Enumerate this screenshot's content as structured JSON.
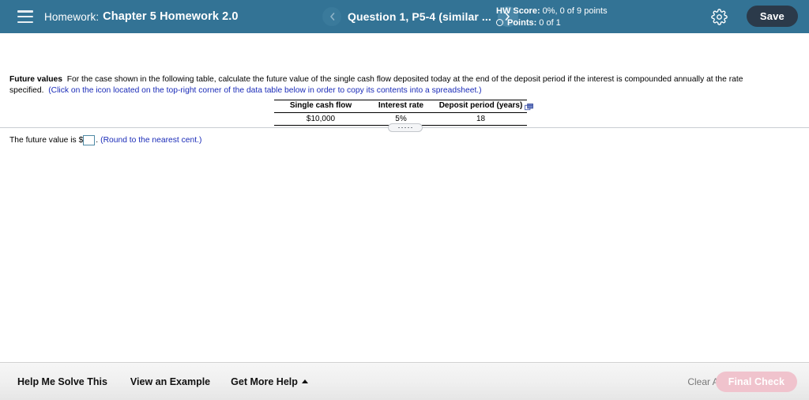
{
  "header": {
    "menu_icon": "hamburger-icon",
    "course_label": "Homework:",
    "assignment_title": "Chapter 5 Homework 2.0",
    "prev_icon": "chevron-left-icon",
    "next_icon": "chevron-right-icon",
    "question_title": "Question 1, P5-4 (similar ...",
    "score": {
      "hw_score_label": "HW Score:",
      "hw_score_value": "0%, 0 of 9 points",
      "points_label": "Points:",
      "points_value": "0 of 1",
      "points_icon": "circle-outline-icon"
    },
    "settings_icon": "gear-icon",
    "save_label": "Save"
  },
  "question": {
    "lead": "Future values",
    "body": "For the case shown in the following table, calculate the future value of the single cash flow deposited today at the end of the deposit period if the interest is compounded annually at the rate specified.",
    "hint_link": "(Click on the icon located on the top-right corner of the data table below in order to copy its contents into a spreadsheet.)",
    "copy_icon": "copy-to-spreadsheet-icon"
  },
  "data_table": {
    "headers": [
      "Single cash flow",
      "Interest rate",
      "Deposit period (years)"
    ],
    "rows": [
      [
        "$10,000",
        "5%",
        "18"
      ]
    ]
  },
  "splitter": {
    "handle_icon": "drag-handle-dots-icon"
  },
  "answer": {
    "prompt_prefix": "The future value is $",
    "input_value": "",
    "input_placeholder": "",
    "prompt_suffix": ".",
    "rounding_note": "(Round to the nearest cent.)"
  },
  "footer": {
    "help_me_solve_this": "Help Me Solve This",
    "view_an_example": "View an Example",
    "get_more_help": "Get More Help",
    "get_more_help_icon": "caret-up-icon",
    "clear_all": "Clear All",
    "final_check": "Final Check"
  },
  "colors": {
    "header_bg": "#337395",
    "save_bg": "#2b3a4a",
    "link": "#1a2bb8",
    "final_check_bg": "#f0c3cd",
    "input_border": "#4f8aa5"
  }
}
